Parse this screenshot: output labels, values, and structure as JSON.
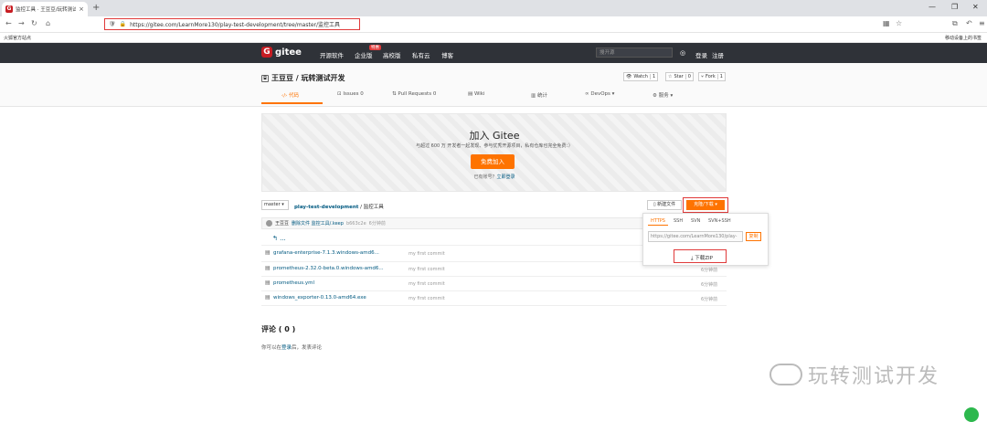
{
  "browser": {
    "tab_title": "监控工具 · 王豆豆/玩转测试开发",
    "new_tab": "+",
    "url": "https://gitee.com/LearnMore130/play-test-development/tree/master/监控工具",
    "bookmark_item": "火狐官方站点",
    "right_bookmark": "移动设备上的书签"
  },
  "header": {
    "logo_text": "gitee",
    "nav": [
      "开源软件",
      "企业版",
      "高校版",
      "私有云",
      "博客"
    ],
    "badge": "特惠",
    "search_placeholder": "搜开源",
    "login": "登录",
    "register": "注册"
  },
  "repo": {
    "title": "王豆豆 / 玩转测试开发",
    "watch_label": "Watch",
    "watch_count": "1",
    "star_label": "Star",
    "star_count": "0",
    "fork_label": "Fork",
    "fork_count": "1",
    "tabs": [
      "代码",
      "Issues",
      "Pull Requests",
      "Wiki",
      "统计",
      "DevOps",
      "服务"
    ],
    "tab_issue_count": "0",
    "tab_pr_count": "0"
  },
  "banner": {
    "title": "加入 Gitee",
    "subtitle": "与超过 600 万 开发者一起发现、参与优秀开源项目，私有仓库也完全免费：）",
    "join_button": "免费加入",
    "login_prompt": "已有账号？",
    "login_link": "立即登录"
  },
  "files": {
    "branch": "master",
    "repo_link": "play-test-development",
    "current_dir": "/ 监控工具",
    "new_file": "新建文件",
    "clone_button": "克隆/下载",
    "commit_author": "王豆豆",
    "commit_msg": "删除文件 监控工具/.keep",
    "commit_hash": "b663c2e",
    "commit_time": "6分钟前",
    "back": "...",
    "rows": [
      {
        "name": "grafana-enterprise-7.1.3.windows-amd6...",
        "msg": "my first commit",
        "time": "6分钟前"
      },
      {
        "name": "prometheus-2.32.0-beta.0.windows-amd6...",
        "msg": "my first commit",
        "time": "6分钟前"
      },
      {
        "name": "prometheus.yml",
        "msg": "my first commit",
        "time": "6分钟前"
      },
      {
        "name": "windows_exporter-0.13.0-amd64.exe",
        "msg": "my first commit",
        "time": "6分钟前"
      }
    ]
  },
  "clone": {
    "protocols": [
      "HTTPS",
      "SSH",
      "SVN",
      "SVN+SSH"
    ],
    "url": "https://gitee.com/LearnMore130/play-",
    "copy": "复制",
    "download_zip": "下载ZIP"
  },
  "comments": {
    "title": "评论 ( 0 )",
    "text_before": "你可以在",
    "login_link": "登录",
    "text_after": "后，发表评论"
  },
  "watermark": "玩转测试开发",
  "colors": {
    "brand": "#c71d23",
    "accent": "#fe7300",
    "link": "#005980",
    "highlight": "#e03a3a"
  }
}
